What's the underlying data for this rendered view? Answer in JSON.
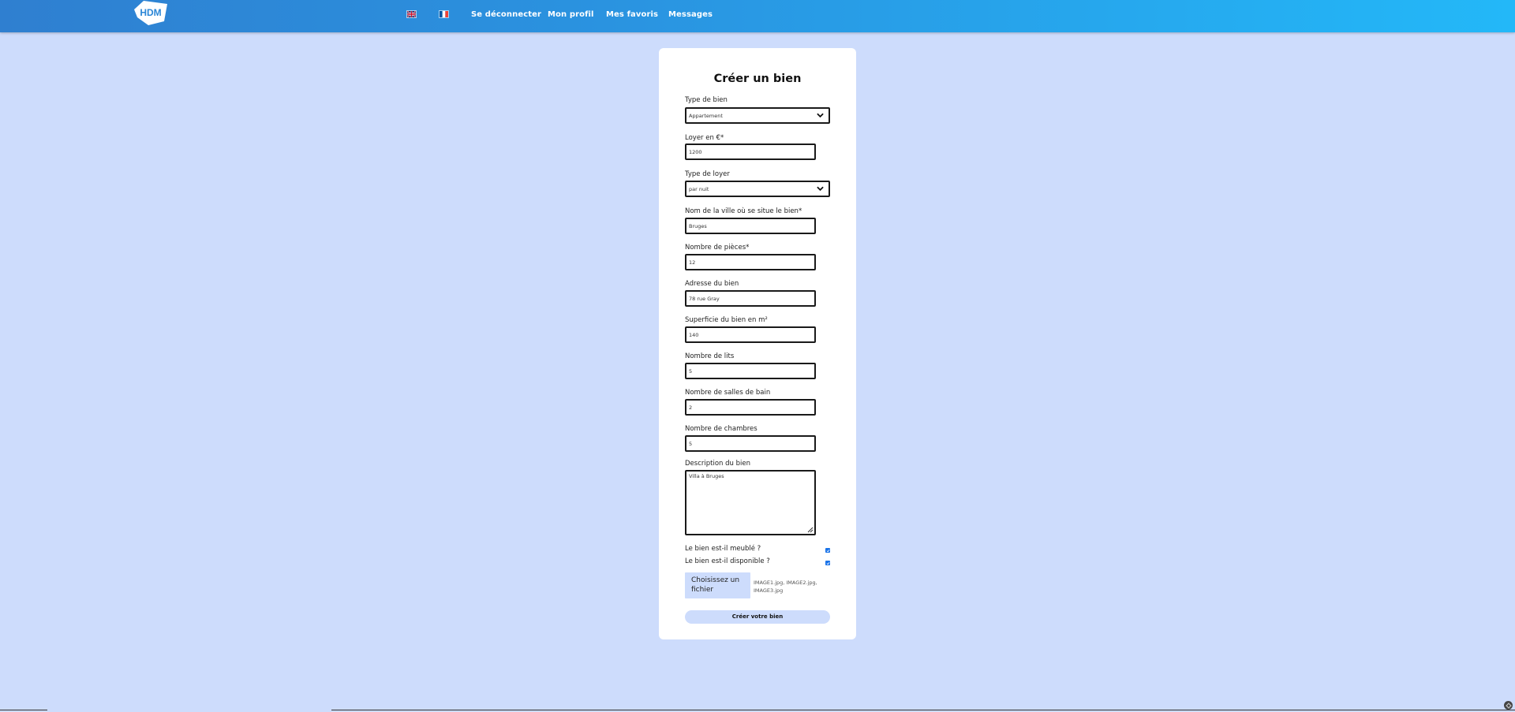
{
  "nav": {
    "logo_text": "HDM",
    "flags": {
      "en": "uk-flag-icon",
      "fr": "fr-flag-icon"
    },
    "links": {
      "logout": "Se déconnecter",
      "profile": "Mon profil",
      "favorites": "Mes favoris",
      "messages": "Messages"
    },
    "gradient_colors": [
      "#2f7fd0",
      "#23b8f8"
    ]
  },
  "form": {
    "title": "Créer un bien",
    "property_type": {
      "label": "Type de bien",
      "value": "Appartement"
    },
    "rent": {
      "label": "Loyer en €*",
      "value": "1200"
    },
    "rent_type": {
      "label": "Type de loyer",
      "value": "par nuit"
    },
    "city": {
      "label": "Nom de la ville où se situe le bien*",
      "value": "Bruges"
    },
    "rooms": {
      "label": "Nombre de pièces*",
      "value": "12"
    },
    "address": {
      "label": "Adresse du bien",
      "value": "78 rue Gray"
    },
    "surface": {
      "label": "Superficie du bien en m²",
      "value": "140"
    },
    "beds": {
      "label": "Nombre de lits",
      "value": "5"
    },
    "bathrooms": {
      "label": "Nombre de salles de bain",
      "value": "2"
    },
    "bedrooms": {
      "label": "Nombre de chambres",
      "value": "5"
    },
    "description": {
      "label": "Description du bien",
      "value": "Villa à Bruges"
    },
    "furnished": {
      "label": "Le bien est-il meublé ?",
      "checked": true
    },
    "available": {
      "label": "Le bien est-il disponible ?",
      "checked": true
    },
    "file": {
      "button_label": "Choisissez un fichier",
      "selected": "IMAGE1.jpg, IMAGE2.jpg, IMAGE3.jpg"
    },
    "submit_label": "Créer votre bien"
  },
  "colors": {
    "page_background": "#cddcfc",
    "card_background": "#ffffff",
    "checkbox_accent": "#1a73e8"
  }
}
